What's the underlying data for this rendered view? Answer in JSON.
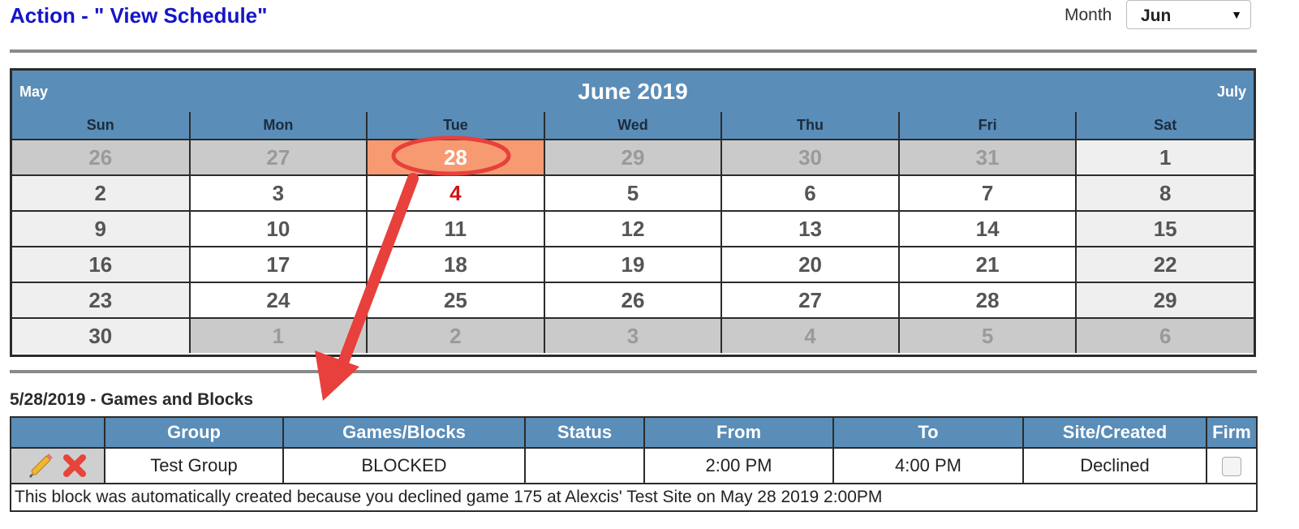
{
  "header": {
    "title": "Action - \" View Schedule\"",
    "month_label": "Month",
    "month_value": "Jun"
  },
  "calendar": {
    "prev": "May",
    "title": "June 2019",
    "next": "July",
    "weekdays": [
      "Sun",
      "Mon",
      "Tue",
      "Wed",
      "Thu",
      "Fri",
      "Sat"
    ],
    "weeks": [
      [
        "26",
        "27",
        "28",
        "29",
        "30",
        "31",
        "1"
      ],
      [
        "2",
        "3",
        "4",
        "5",
        "6",
        "7",
        "8"
      ],
      [
        "9",
        "10",
        "11",
        "12",
        "13",
        "14",
        "15"
      ],
      [
        "16",
        "17",
        "18",
        "19",
        "20",
        "21",
        "22"
      ],
      [
        "23",
        "24",
        "25",
        "26",
        "27",
        "28",
        "29"
      ],
      [
        "30",
        "1",
        "2",
        "3",
        "4",
        "5",
        "6"
      ]
    ]
  },
  "events": {
    "section_title": "5/28/2019 - Games and Blocks",
    "columns": [
      "",
      "Group",
      "Games/Blocks",
      "Status",
      "From",
      "To",
      "Site/Created",
      "Firm"
    ],
    "rows": [
      {
        "group": "Test Group",
        "games_blocks": "BLOCKED",
        "status": "",
        "from": "2:00 PM",
        "to": "4:00 PM",
        "site_created": "Declined",
        "firm": false,
        "note": "This block was automatically created because you declined game 175 at Alexcis' Test Site on May 28 2019 2:00PM"
      }
    ]
  },
  "colors": {
    "title": "#1515c8",
    "header_blue": "#5a8db8",
    "selected_day": "#f79a71",
    "today": "#d11414",
    "annotation_red": "#e8403c"
  },
  "icons": {
    "edit": "pencil-icon",
    "delete": "close-x-icon"
  }
}
